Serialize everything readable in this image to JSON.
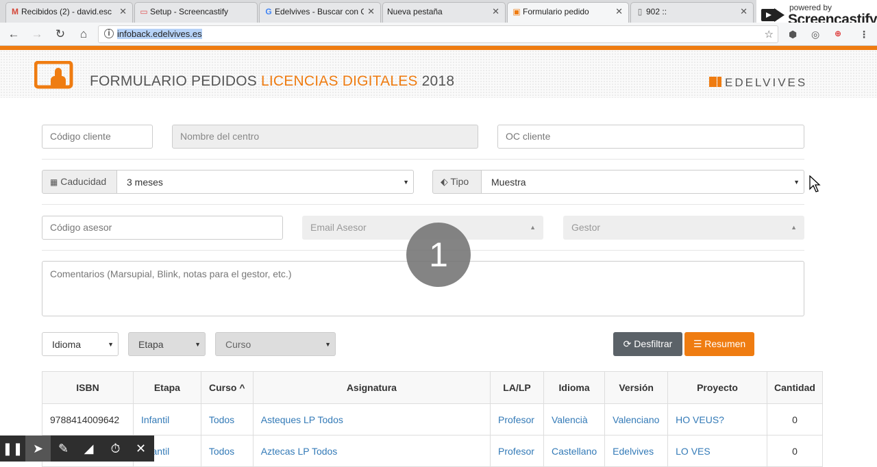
{
  "browser": {
    "tabs": [
      {
        "title": "Recibidos (2) - david.esc",
        "icon": "gmail-icon"
      },
      {
        "title": "Setup - Screencastify",
        "icon": "screencastify-icon"
      },
      {
        "title": "Edelvives - Buscar con G",
        "icon": "google-icon"
      },
      {
        "title": "Nueva pestaña",
        "icon": ""
      },
      {
        "title": "Formulario pedido",
        "icon": "edelvives-icon",
        "active": true
      },
      {
        "title": "902 ::",
        "icon": "page-icon"
      }
    ],
    "url": "infoback.edelvives.es",
    "accent": "#ef7c11"
  },
  "screencastify": {
    "powered_by": "powered by",
    "name": "Screencastify"
  },
  "header": {
    "title_part1": "FORMULARIO PEDIDOS ",
    "title_highlight": "LICENCIAS DIGITALES",
    "title_part2": " 2018",
    "brand": "EDELVIVES"
  },
  "form": {
    "codigo_cliente": {
      "placeholder": "Código cliente"
    },
    "nombre_centro": {
      "placeholder": "Nombre del centro"
    },
    "oc_cliente": {
      "placeholder": "OC cliente"
    },
    "caducidad": {
      "label": "Caducidad",
      "value": "3 meses"
    },
    "tipo": {
      "label": "Tipo",
      "value": "Muestra"
    },
    "codigo_asesor": {
      "placeholder": "Código asesor"
    },
    "email_asesor": {
      "placeholder": "Email Asesor"
    },
    "gestor": {
      "placeholder": "Gestor"
    },
    "comentarios": {
      "placeholder": "Comentarios (Marsupial, Blink, notas para el gestor, etc.)"
    }
  },
  "filters": {
    "idioma": "Idioma",
    "etapa": "Etapa",
    "curso": "Curso",
    "desfiltrar": "Desfiltrar",
    "resumen": "Resumen"
  },
  "table": {
    "headers": [
      "ISBN",
      "Etapa",
      "Curso ^",
      "Asignatura",
      "LA/LP",
      "Idioma",
      "Versión",
      "Proyecto",
      "Cantidad"
    ],
    "rows": [
      [
        "9788414009642",
        "Infantil",
        "Todos",
        "Asteques LP Todos",
        "Profesor",
        "Valencià",
        "Valenciano",
        "HO VEUS?",
        "0"
      ],
      [
        "",
        "Infantil",
        "Todos",
        "Aztecas LP Todos",
        "Profesor",
        "Castellano",
        "Edelvives",
        "LO VES",
        "0"
      ]
    ]
  },
  "overlay": {
    "step": "1"
  }
}
